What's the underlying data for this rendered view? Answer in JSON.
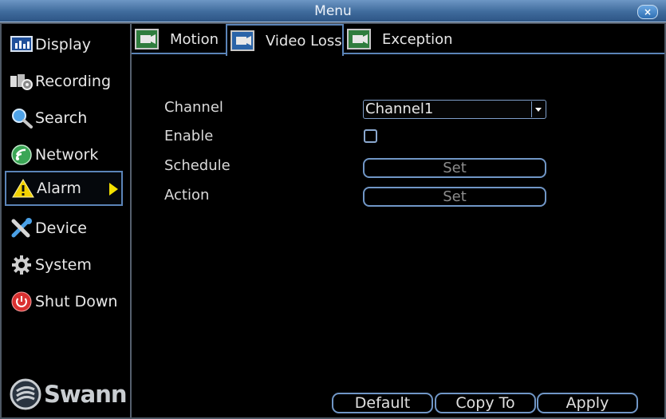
{
  "window": {
    "title": "Menu",
    "close_label": "×"
  },
  "sidebar": {
    "items": [
      {
        "label": "Display",
        "icon": "display-icon"
      },
      {
        "label": "Recording",
        "icon": "recording-icon"
      },
      {
        "label": "Search",
        "icon": "search-icon"
      },
      {
        "label": "Network",
        "icon": "network-icon"
      },
      {
        "label": "Alarm",
        "icon": "warning-icon",
        "active": true
      },
      {
        "label": "Device",
        "icon": "device-tools-icon"
      },
      {
        "label": "System",
        "icon": "gear-icon"
      },
      {
        "label": "Shut Down",
        "icon": "power-icon"
      }
    ],
    "logo_text": "Swann"
  },
  "tabs": [
    {
      "label": "Motion",
      "icon": "motion-camera-icon"
    },
    {
      "label": "Video Loss",
      "icon": "video-loss-camera-icon",
      "active": true
    },
    {
      "label": "Exception",
      "icon": "exception-camera-icon"
    }
  ],
  "form": {
    "channel_label": "Channel",
    "channel_value": "Channel1",
    "enable_label": "Enable",
    "enable_checked": false,
    "schedule_label": "Schedule",
    "schedule_button": "Set",
    "action_label": "Action",
    "action_button": "Set"
  },
  "footer": {
    "default_label": "Default",
    "copy_to_label": "Copy To",
    "apply_label": "Apply"
  },
  "colors": {
    "accent": "#5b84b8",
    "titlebar": "#3f6b9c",
    "alarm_arrow": "#f4e100"
  }
}
